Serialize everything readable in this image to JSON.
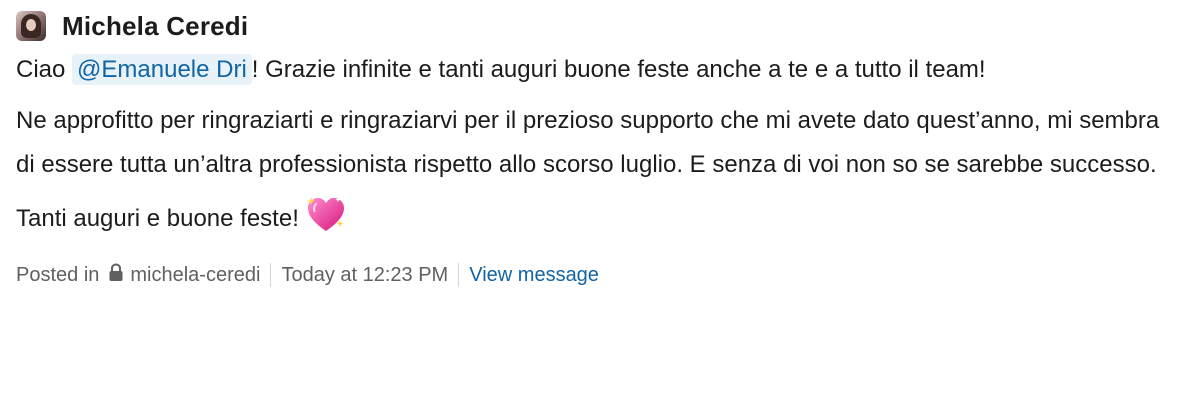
{
  "message": {
    "author": "Michela Ceredi",
    "paragraphs": [
      {
        "prefix": "Ciao ",
        "mention": "@Emanuele Dri",
        "suffix": "! Grazie infinite e tanti auguri buone feste anche a te e a tutto il team!"
      },
      {
        "text": "Ne approfitto per ringraziarti e ringraziarvi per il prezioso supporto che mi avete dato quest’anno, mi sembra di essere tutta un’altra professionista rispetto allo scorso luglio. E senza di voi non so se sarebbe successo."
      },
      {
        "text": "Tanti auguri e buone feste!",
        "emoji": "sparkling-heart-icon"
      }
    ]
  },
  "footer": {
    "posted_in": "Posted in",
    "channel_icon": "lock-icon",
    "channel": "michela-ceredi",
    "timestamp": "Today at 12:23 PM",
    "view_message": "View message"
  },
  "colors": {
    "link": "#1264a3",
    "mention_bg": "#e8f2f9",
    "muted": "#616061",
    "text": "#1d1c1d"
  }
}
